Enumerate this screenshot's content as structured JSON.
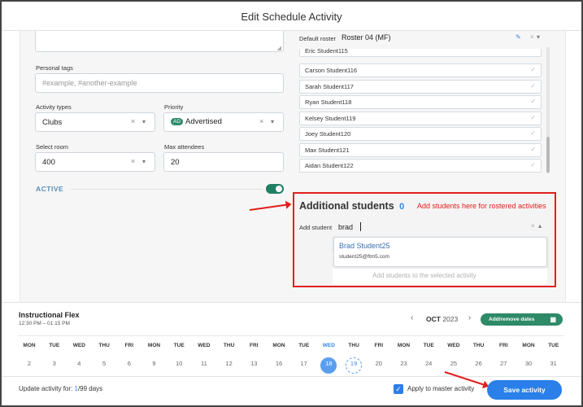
{
  "modal": {
    "title": "Edit Schedule Activity"
  },
  "form": {
    "personal_tags_label": "Personal tags",
    "personal_tags_placeholder": "#example, #another-example",
    "activity_types_label": "Activity types",
    "activity_types_value": "Clubs",
    "priority_label": "Priority",
    "priority_badge": "AD",
    "priority_value": "Advertised",
    "select_room_label": "Select room",
    "select_room_value": "400",
    "max_attendees_label": "Max attendees",
    "max_attendees_value": "20",
    "active_label": "ACTIVE",
    "clear_symbol": "×",
    "caret_symbol": "▾"
  },
  "roster": {
    "default_label": "Default roster",
    "default_value": "Roster 04 (MF)",
    "partial_item": "Eric Student115",
    "items": [
      "Carson Student116",
      "Sarah Student117",
      "Ryan Student118",
      "Kelsey Student119",
      "Joey Student120",
      "Max Student121",
      "Aidan Student122"
    ],
    "check_symbol": "✓"
  },
  "additional": {
    "title": "Additional students",
    "count": "0",
    "annotation": "Add students here for rostered activities",
    "add_label": "Add student",
    "add_value": "brad",
    "result_name": "Brad Student25",
    "result_email": "student25@ftm5.com",
    "hint": "Add students to the selected activity"
  },
  "schedule": {
    "title": "Instructional Flex",
    "time": "12:30 PM – 01:15 PM",
    "month": "OCT",
    "year": "2023",
    "prev": "‹",
    "next": "›",
    "add_remove_label": "Add/remove dates",
    "days": [
      {
        "name": "MON",
        "num": "2"
      },
      {
        "name": "TUE",
        "num": "3"
      },
      {
        "name": "WED",
        "num": "4"
      },
      {
        "name": "THU",
        "num": "5"
      },
      {
        "name": "FRI",
        "num": "6"
      },
      {
        "name": "MON",
        "num": "9"
      },
      {
        "name": "TUE",
        "num": "10"
      },
      {
        "name": "WED",
        "num": "11"
      },
      {
        "name": "THU",
        "num": "12"
      },
      {
        "name": "FRI",
        "num": "13"
      },
      {
        "name": "MON",
        "num": "16"
      },
      {
        "name": "TUE",
        "num": "17"
      },
      {
        "name": "WED",
        "num": "18"
      },
      {
        "name": "THU",
        "num": "19"
      },
      {
        "name": "FRI",
        "num": "20"
      },
      {
        "name": "MON",
        "num": "23"
      },
      {
        "name": "TUE",
        "num": "24"
      },
      {
        "name": "WED",
        "num": "25"
      },
      {
        "name": "THU",
        "num": "26"
      },
      {
        "name": "FRI",
        "num": "27"
      },
      {
        "name": "MON",
        "num": "30"
      },
      {
        "name": "TUE",
        "num": "31"
      }
    ]
  },
  "footer": {
    "update_prefix": "Update activity for: ",
    "update_count": "1",
    "update_suffix": "/99 days",
    "apply_master_label": "Apply to master activity",
    "save_label": "Save activity"
  },
  "colors": {
    "accent_blue": "#2a7fe8",
    "green": "#2e8a67",
    "annotation_red": "#e0201e"
  }
}
